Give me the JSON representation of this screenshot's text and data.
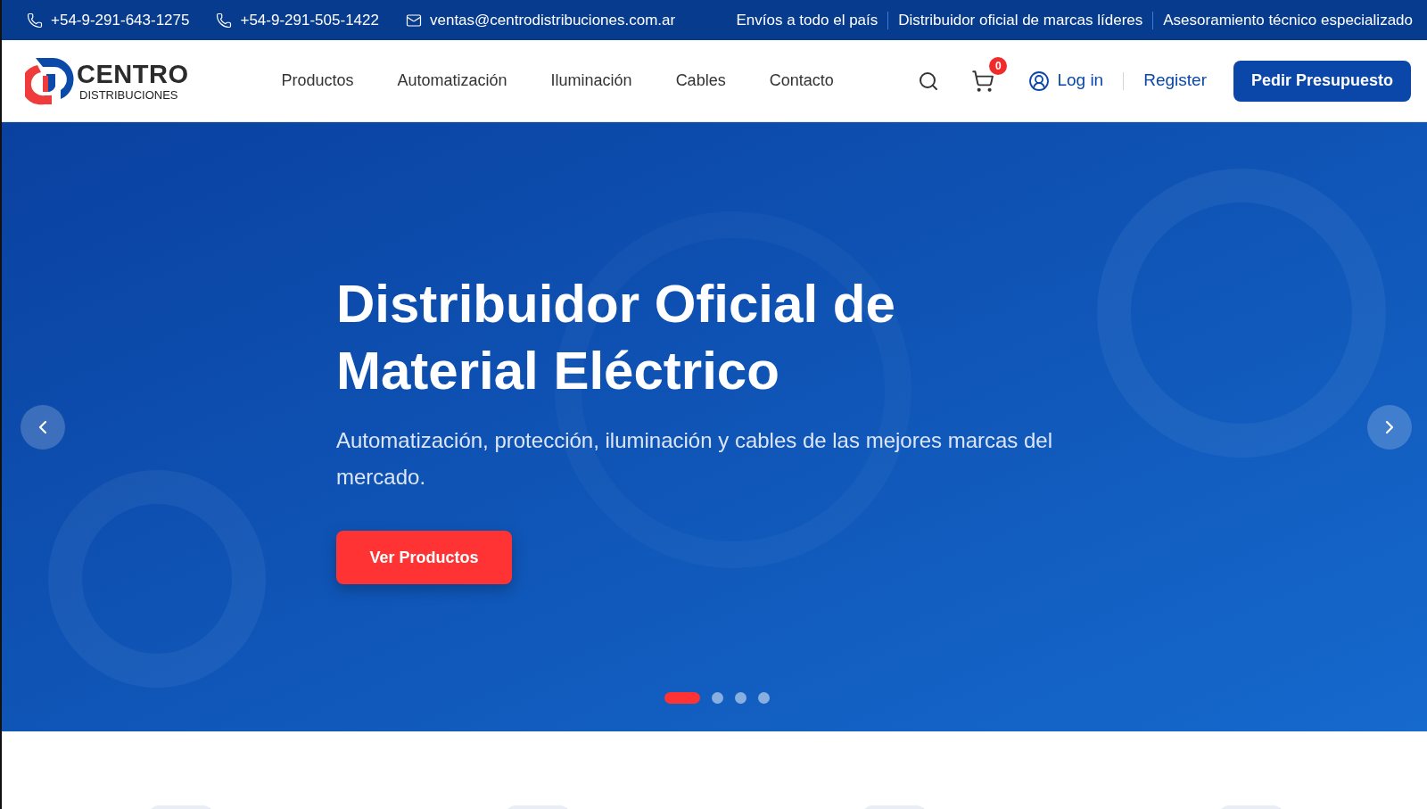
{
  "top_bar": {
    "contacts": [
      {
        "kind": "phone",
        "text": "+54-9-291-643-1275"
      },
      {
        "kind": "phone",
        "text": "+54-9-291-505-1422"
      },
      {
        "kind": "email",
        "text": "ventas@centrodistribuciones.com.ar"
      }
    ],
    "highlights": [
      "Envíos a todo el país",
      "Distribuidor oficial de marcas líderes",
      "Asesoramiento técnico especializado"
    ]
  },
  "header": {
    "logo": {
      "name": "CENTRO",
      "tagline": "DISTRIBUCIONES"
    },
    "nav": [
      "Productos",
      "Automatización",
      "Iluminación",
      "Cables",
      "Contacto"
    ],
    "cart_count": "0",
    "login": "Log in",
    "register": "Register",
    "cta": "Pedir Presupuesto"
  },
  "hero": {
    "title": "Distribuidor Oficial de Material Eléctrico",
    "subtitle": "Automatización, protección, iluminación y cables de las mejores marcas del mercado.",
    "button": "Ver Productos",
    "slides": [
      {
        "selected": true
      },
      {
        "selected": false
      },
      {
        "selected": false
      },
      {
        "selected": false
      }
    ]
  }
}
